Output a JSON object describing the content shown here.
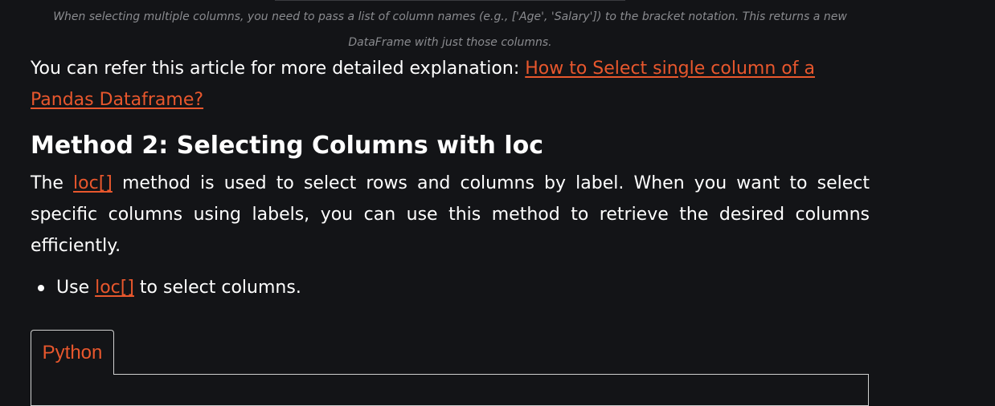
{
  "caption": "When selecting multiple columns, you need to pass a list of column names (e.g., ['Age', 'Salary']) to the bracket notation. This returns a new DataFrame with just those columns.",
  "refer_paragraph": {
    "text": "You can refer this article for more detailed explanation: ",
    "link": "How to Select single column of a Pandas Dataframe?"
  },
  "heading": "Method 2: Selecting Columns with loc",
  "loc_paragraph": {
    "prefix": "The ",
    "link": "loc[]",
    "suffix": " method is used to select rows and columns by label. When you want to select specific columns using labels, you can use this method to retrieve the desired columns efficiently."
  },
  "bullet": {
    "prefix": "Use ",
    "link": "loc[]",
    "suffix": " to select columns."
  },
  "code_tab": {
    "label": "Python"
  },
  "colors": {
    "background": "#131417",
    "text": "#ffffff",
    "link": "#e8572d",
    "caption": "#8a8b8f"
  }
}
